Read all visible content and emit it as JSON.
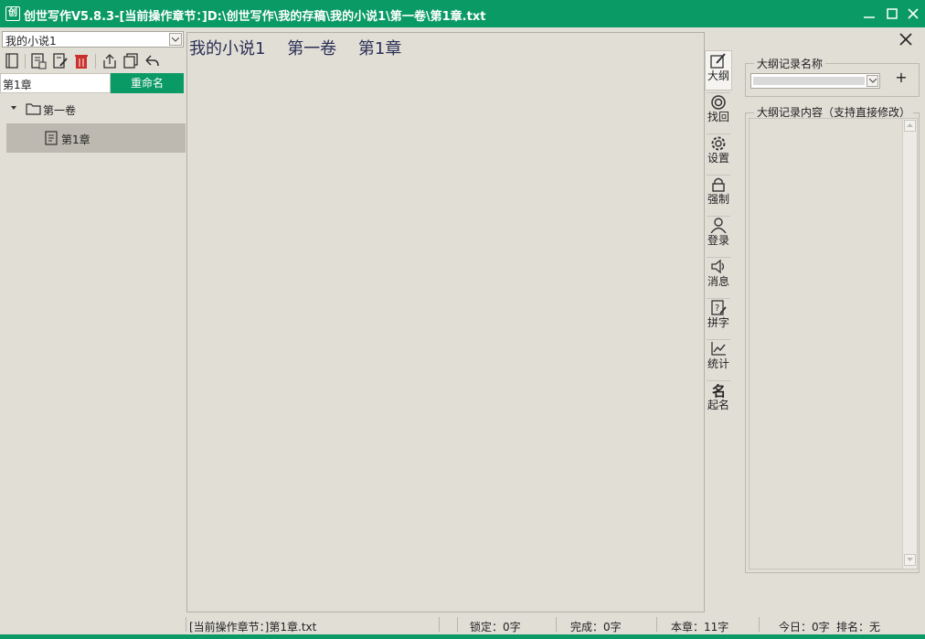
{
  "window": {
    "app_icon_glyph": "创",
    "title": "创世写作V5.8.3-[当前操作章节：]D:\\创世写作\\我的存稿\\我的小说1\\第一卷\\第1章.txt",
    "accent_color": "#0a9a66"
  },
  "left": {
    "novel_select_value": "我的小说1",
    "rename_input_value": "第1章",
    "rename_button": "重命名",
    "tree": {
      "volume": "第一卷",
      "chapter": "第1章"
    }
  },
  "editor": {
    "novel": "我的小说1",
    "volume": "第一卷",
    "chapter": "第1章"
  },
  "side_tools": [
    {
      "label": "大纲",
      "icon": "outline-edit-icon"
    },
    {
      "label": "找回",
      "icon": "recover-icon"
    },
    {
      "label": "设置",
      "icon": "gear-icon"
    },
    {
      "label": "强制",
      "icon": "lock-icon"
    },
    {
      "label": "登录",
      "icon": "user-icon"
    },
    {
      "label": "消息",
      "icon": "speaker-icon"
    },
    {
      "label": "拼字",
      "icon": "spell-icon"
    },
    {
      "label": "统计",
      "icon": "chart-icon"
    },
    {
      "label": "起名",
      "icon": "name-icon"
    }
  ],
  "outline": {
    "name_legend": "大纲记录名称",
    "add_label": "+",
    "content_legend": "大纲记录内容（支持直接修改）"
  },
  "status": {
    "current_chapter": "[当前操作章节：]第1章.txt",
    "locked": "锁定：0字",
    "done": "完成：0字",
    "chapter_count": "本章：11字",
    "today": "今日：0字",
    "rank": "排名：无"
  }
}
